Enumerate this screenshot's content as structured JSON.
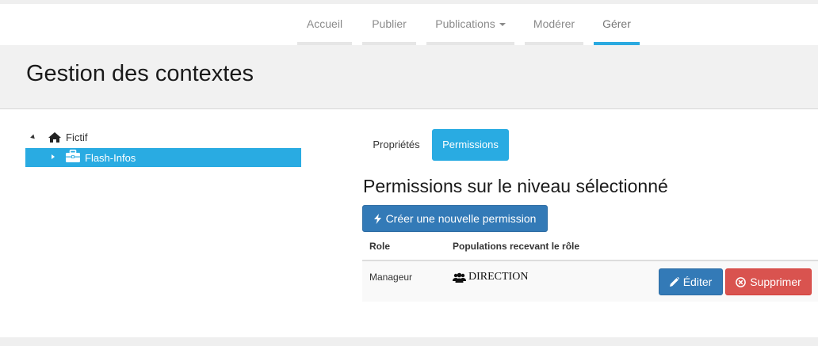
{
  "nav": {
    "items": [
      {
        "label": "Accueil"
      },
      {
        "label": "Publier"
      },
      {
        "label": "Publications"
      },
      {
        "label": "Modérer"
      },
      {
        "label": "Gérer"
      }
    ],
    "active_index": 4
  },
  "page": {
    "title": "Gestion des contextes"
  },
  "tree": {
    "root": {
      "label": "Fictif",
      "icon": "home-icon",
      "expanded": true
    },
    "child": {
      "label": "Flash-Infos",
      "icon": "briefcase-icon",
      "selected": true,
      "expanded": false
    }
  },
  "tabs": {
    "items": [
      {
        "label": "Propriétés"
      },
      {
        "label": "Permissions"
      }
    ],
    "active_index": 1
  },
  "permissions": {
    "title": "Permissions sur le niveau sélectionné",
    "create_button": {
      "label": "Créer une nouvelle permission",
      "icon": "bolt-icon"
    },
    "table": {
      "columns": [
        "Role",
        "Populations recevant le rôle",
        ""
      ],
      "rows": [
        {
          "role": "Manageur",
          "population": "DIRECTION",
          "population_icon": "users-icon",
          "edit_label": "Éditer",
          "delete_label": "Supprimer"
        }
      ]
    }
  },
  "colors": {
    "accent": "#29abe2",
    "primary": "#337ab7",
    "danger": "#d9534f",
    "header_bg": "#f1f1f1"
  }
}
